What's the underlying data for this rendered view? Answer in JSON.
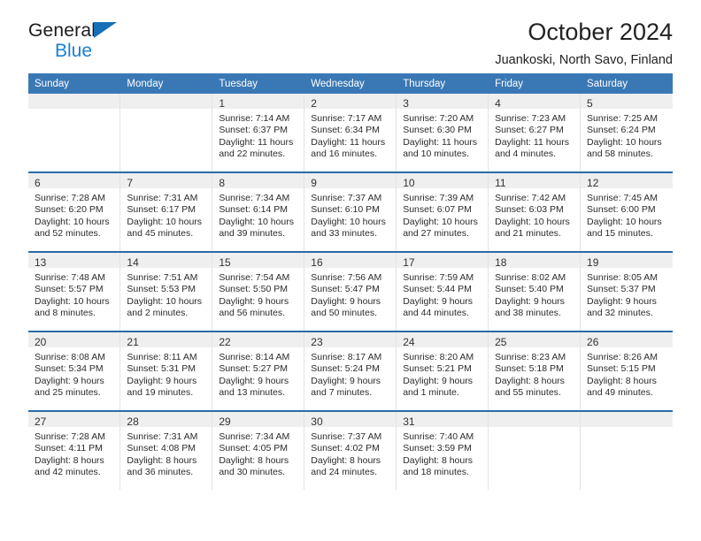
{
  "brand": {
    "name_top": "General",
    "name_bottom": "Blue",
    "triangle_color": "#1670b8",
    "bottom_color": "#1a7fd4"
  },
  "header": {
    "title": "October 2024",
    "subtitle": "Juankoski, North Savo, Finland"
  },
  "theme": {
    "header_bg": "#3a78b5",
    "week_divider": "#2a6ca8",
    "daynum_band": "#efefef"
  },
  "calendar": {
    "weekday_headers": [
      "Sunday",
      "Monday",
      "Tuesday",
      "Wednesday",
      "Thursday",
      "Friday",
      "Saturday"
    ],
    "weeks": [
      [
        {
          "day": "",
          "empty": true
        },
        {
          "day": "",
          "empty": true
        },
        {
          "day": "1",
          "sunrise": "Sunrise: 7:14 AM",
          "sunset": "Sunset: 6:37 PM",
          "daylight1": "Daylight: 11 hours",
          "daylight2": "and 22 minutes."
        },
        {
          "day": "2",
          "sunrise": "Sunrise: 7:17 AM",
          "sunset": "Sunset: 6:34 PM",
          "daylight1": "Daylight: 11 hours",
          "daylight2": "and 16 minutes."
        },
        {
          "day": "3",
          "sunrise": "Sunrise: 7:20 AM",
          "sunset": "Sunset: 6:30 PM",
          "daylight1": "Daylight: 11 hours",
          "daylight2": "and 10 minutes."
        },
        {
          "day": "4",
          "sunrise": "Sunrise: 7:23 AM",
          "sunset": "Sunset: 6:27 PM",
          "daylight1": "Daylight: 11 hours",
          "daylight2": "and 4 minutes."
        },
        {
          "day": "5",
          "sunrise": "Sunrise: 7:25 AM",
          "sunset": "Sunset: 6:24 PM",
          "daylight1": "Daylight: 10 hours",
          "daylight2": "and 58 minutes."
        }
      ],
      [
        {
          "day": "6",
          "sunrise": "Sunrise: 7:28 AM",
          "sunset": "Sunset: 6:20 PM",
          "daylight1": "Daylight: 10 hours",
          "daylight2": "and 52 minutes."
        },
        {
          "day": "7",
          "sunrise": "Sunrise: 7:31 AM",
          "sunset": "Sunset: 6:17 PM",
          "daylight1": "Daylight: 10 hours",
          "daylight2": "and 45 minutes."
        },
        {
          "day": "8",
          "sunrise": "Sunrise: 7:34 AM",
          "sunset": "Sunset: 6:14 PM",
          "daylight1": "Daylight: 10 hours",
          "daylight2": "and 39 minutes."
        },
        {
          "day": "9",
          "sunrise": "Sunrise: 7:37 AM",
          "sunset": "Sunset: 6:10 PM",
          "daylight1": "Daylight: 10 hours",
          "daylight2": "and 33 minutes."
        },
        {
          "day": "10",
          "sunrise": "Sunrise: 7:39 AM",
          "sunset": "Sunset: 6:07 PM",
          "daylight1": "Daylight: 10 hours",
          "daylight2": "and 27 minutes."
        },
        {
          "day": "11",
          "sunrise": "Sunrise: 7:42 AM",
          "sunset": "Sunset: 6:03 PM",
          "daylight1": "Daylight: 10 hours",
          "daylight2": "and 21 minutes."
        },
        {
          "day": "12",
          "sunrise": "Sunrise: 7:45 AM",
          "sunset": "Sunset: 6:00 PM",
          "daylight1": "Daylight: 10 hours",
          "daylight2": "and 15 minutes."
        }
      ],
      [
        {
          "day": "13",
          "sunrise": "Sunrise: 7:48 AM",
          "sunset": "Sunset: 5:57 PM",
          "daylight1": "Daylight: 10 hours",
          "daylight2": "and 8 minutes."
        },
        {
          "day": "14",
          "sunrise": "Sunrise: 7:51 AM",
          "sunset": "Sunset: 5:53 PM",
          "daylight1": "Daylight: 10 hours",
          "daylight2": "and 2 minutes."
        },
        {
          "day": "15",
          "sunrise": "Sunrise: 7:54 AM",
          "sunset": "Sunset: 5:50 PM",
          "daylight1": "Daylight: 9 hours",
          "daylight2": "and 56 minutes."
        },
        {
          "day": "16",
          "sunrise": "Sunrise: 7:56 AM",
          "sunset": "Sunset: 5:47 PM",
          "daylight1": "Daylight: 9 hours",
          "daylight2": "and 50 minutes."
        },
        {
          "day": "17",
          "sunrise": "Sunrise: 7:59 AM",
          "sunset": "Sunset: 5:44 PM",
          "daylight1": "Daylight: 9 hours",
          "daylight2": "and 44 minutes."
        },
        {
          "day": "18",
          "sunrise": "Sunrise: 8:02 AM",
          "sunset": "Sunset: 5:40 PM",
          "daylight1": "Daylight: 9 hours",
          "daylight2": "and 38 minutes."
        },
        {
          "day": "19",
          "sunrise": "Sunrise: 8:05 AM",
          "sunset": "Sunset: 5:37 PM",
          "daylight1": "Daylight: 9 hours",
          "daylight2": "and 32 minutes."
        }
      ],
      [
        {
          "day": "20",
          "sunrise": "Sunrise: 8:08 AM",
          "sunset": "Sunset: 5:34 PM",
          "daylight1": "Daylight: 9 hours",
          "daylight2": "and 25 minutes."
        },
        {
          "day": "21",
          "sunrise": "Sunrise: 8:11 AM",
          "sunset": "Sunset: 5:31 PM",
          "daylight1": "Daylight: 9 hours",
          "daylight2": "and 19 minutes."
        },
        {
          "day": "22",
          "sunrise": "Sunrise: 8:14 AM",
          "sunset": "Sunset: 5:27 PM",
          "daylight1": "Daylight: 9 hours",
          "daylight2": "and 13 minutes."
        },
        {
          "day": "23",
          "sunrise": "Sunrise: 8:17 AM",
          "sunset": "Sunset: 5:24 PM",
          "daylight1": "Daylight: 9 hours",
          "daylight2": "and 7 minutes."
        },
        {
          "day": "24",
          "sunrise": "Sunrise: 8:20 AM",
          "sunset": "Sunset: 5:21 PM",
          "daylight1": "Daylight: 9 hours",
          "daylight2": "and 1 minute."
        },
        {
          "day": "25",
          "sunrise": "Sunrise: 8:23 AM",
          "sunset": "Sunset: 5:18 PM",
          "daylight1": "Daylight: 8 hours",
          "daylight2": "and 55 minutes."
        },
        {
          "day": "26",
          "sunrise": "Sunrise: 8:26 AM",
          "sunset": "Sunset: 5:15 PM",
          "daylight1": "Daylight: 8 hours",
          "daylight2": "and 49 minutes."
        }
      ],
      [
        {
          "day": "27",
          "sunrise": "Sunrise: 7:28 AM",
          "sunset": "Sunset: 4:11 PM",
          "daylight1": "Daylight: 8 hours",
          "daylight2": "and 42 minutes."
        },
        {
          "day": "28",
          "sunrise": "Sunrise: 7:31 AM",
          "sunset": "Sunset: 4:08 PM",
          "daylight1": "Daylight: 8 hours",
          "daylight2": "and 36 minutes."
        },
        {
          "day": "29",
          "sunrise": "Sunrise: 7:34 AM",
          "sunset": "Sunset: 4:05 PM",
          "daylight1": "Daylight: 8 hours",
          "daylight2": "and 30 minutes."
        },
        {
          "day": "30",
          "sunrise": "Sunrise: 7:37 AM",
          "sunset": "Sunset: 4:02 PM",
          "daylight1": "Daylight: 8 hours",
          "daylight2": "and 24 minutes."
        },
        {
          "day": "31",
          "sunrise": "Sunrise: 7:40 AM",
          "sunset": "Sunset: 3:59 PM",
          "daylight1": "Daylight: 8 hours",
          "daylight2": "and 18 minutes."
        },
        {
          "day": "",
          "empty": true
        },
        {
          "day": "",
          "empty": true
        }
      ]
    ]
  }
}
